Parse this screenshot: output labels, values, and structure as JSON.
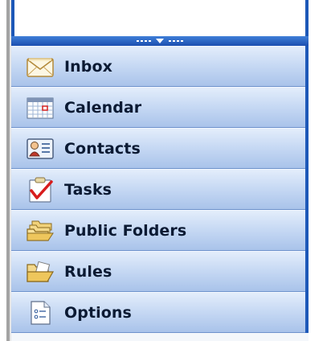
{
  "nav_pane": {
    "buttons": [
      {
        "label": "Inbox",
        "icon": "envelope-icon"
      },
      {
        "label": "Calendar",
        "icon": "calendar-icon"
      },
      {
        "label": "Contacts",
        "icon": "contact-card-icon"
      },
      {
        "label": "Tasks",
        "icon": "clipboard-check-icon"
      },
      {
        "label": "Public Folders",
        "icon": "folder-stack-icon"
      },
      {
        "label": "Rules",
        "icon": "folder-rules-icon"
      },
      {
        "label": "Options",
        "icon": "options-document-icon"
      }
    ],
    "colors": {
      "accent": "#1d58b8",
      "button_top": "#e3edfb",
      "button_bottom": "#a9c3ea",
      "label": "#0b1a33"
    }
  }
}
